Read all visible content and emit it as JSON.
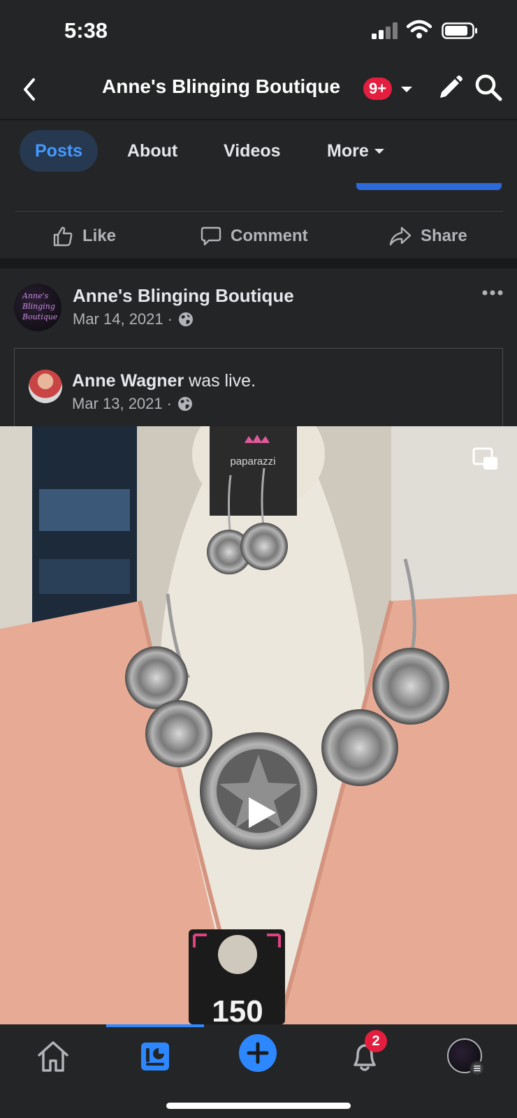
{
  "status_bar": {
    "time": "5:38"
  },
  "header": {
    "title": "Anne's Blinging Boutique",
    "notification_badge": "9+",
    "icons": [
      "back-icon",
      "chevron-down-icon",
      "pencil-icon",
      "search-icon"
    ]
  },
  "tabs": [
    {
      "label": "Posts",
      "active": true
    },
    {
      "label": "About",
      "active": false
    },
    {
      "label": "Videos",
      "active": false
    },
    {
      "label": "More",
      "active": false
    }
  ],
  "actions": {
    "like": "Like",
    "comment": "Comment",
    "share": "Share"
  },
  "post": {
    "author": "Anne's Blinging Boutique",
    "date": "Mar 14, 2021",
    "separator": "·",
    "avatar_script": "Anne's Blinging Boutique",
    "shared": {
      "author": "Anne Wagner",
      "action": "was live.",
      "date": "Mar 13, 2021"
    },
    "video": {
      "brand_tag": "paparazzi",
      "price_tag": "150"
    }
  },
  "bottom_nav": {
    "notification_count": "2",
    "items": [
      "home-icon",
      "page-icon",
      "create-icon",
      "bell-icon",
      "profile-avatar"
    ]
  },
  "colors": {
    "background": "#242526",
    "divider": "#18191a",
    "accent": "#2d88ff",
    "tab_active_bg": "#263951",
    "tab_active_text": "#4599ff",
    "badge": "#e41e3f",
    "secondary_text": "#b0b3b8"
  }
}
